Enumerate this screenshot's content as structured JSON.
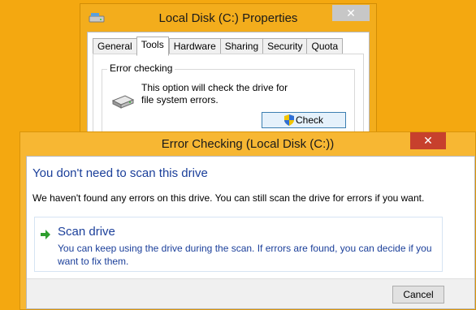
{
  "properties_window": {
    "title": "Local Disk (C:) Properties",
    "close_glyph": "✕",
    "tabs": [
      {
        "label": "General",
        "active": false
      },
      {
        "label": "Tools",
        "active": true
      },
      {
        "label": "Hardware",
        "active": false
      },
      {
        "label": "Sharing",
        "active": false
      },
      {
        "label": "Security",
        "active": false
      },
      {
        "label": "Quota",
        "active": false
      }
    ],
    "error_checking": {
      "group_label": "Error checking",
      "description": "This option will check the drive for file system errors.",
      "check_button": "Check"
    }
  },
  "dialog": {
    "title": "Error Checking (Local Disk (C:))",
    "close_glyph": "✕",
    "heading": "You don't need to scan this drive",
    "info": "We haven't found any errors on this drive. You can still scan the drive for errors if you want.",
    "command": {
      "title": "Scan drive",
      "description": "You can keep using the drive during the scan. If errors are found, you can decide if you want to fix them."
    },
    "cancel_button": "Cancel"
  },
  "colors": {
    "desktop": "#f4a810",
    "window_frame": "#f7b733",
    "close_active": "#c7402d",
    "link_blue": "#1b3f9a",
    "arrow_green": "#2e9e2e"
  },
  "icons": {
    "app": "drive-icon",
    "group": "hard-disk-icon",
    "check": "uac-shield-icon",
    "command": "green-arrow-icon"
  }
}
